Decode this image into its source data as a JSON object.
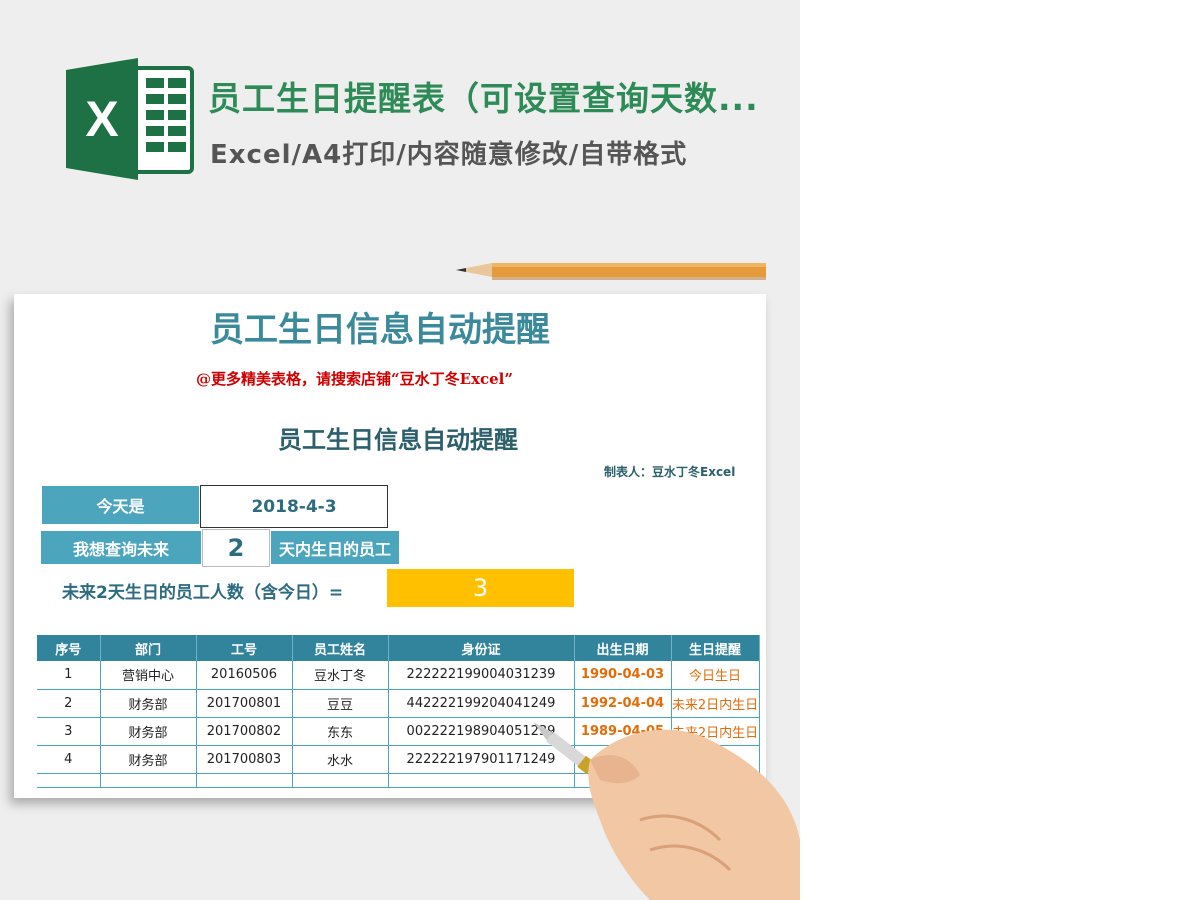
{
  "header": {
    "title": "员工生日提醒表（可设置查询天数...",
    "subtitle": "Excel/A4打印/内容随意修改/自带格式",
    "logo_letter": "X"
  },
  "sheet": {
    "title": "员工生日信息自动提醒",
    "ad": "@更多精美表格，请搜索店铺“豆水丁冬Excel”",
    "subtitle": "员工生日信息自动提醒",
    "maker": "制表人：豆水丁冬Excel",
    "today_label": "今天是",
    "today_value": "2018-4-3",
    "query_label": "我想查询未来",
    "query_days": "2",
    "query_suffix": "天内生日的员工",
    "count_label": "未来2天生日的员工人数（含今日）=",
    "count_value": "3"
  },
  "table": {
    "headers": [
      "序号",
      "部门",
      "工号",
      "员工姓名",
      "身份证",
      "出生日期",
      "生日提醒"
    ],
    "rows": [
      [
        "1",
        "营销中心",
        "20160506",
        "豆水丁冬",
        "222222199004031239",
        "1990-04-03",
        "今日生日"
      ],
      [
        "2",
        "财务部",
        "201700801",
        "豆豆",
        "442222199204041249",
        "1992-04-04",
        "未来2日内生日"
      ],
      [
        "3",
        "财务部",
        "201700802",
        "东东",
        "002222198904051239",
        "1989-04-05",
        "未来2日内生日"
      ],
      [
        "4",
        "财务部",
        "201700803",
        "水水",
        "222222197901171249",
        "",
        ""
      ]
    ]
  },
  "colors": {
    "header_green": "#2e8b57",
    "title_teal": "#3a8a9c",
    "label_blue": "#4aa5bd",
    "table_header": "#31849b",
    "count_yellow": "#ffc000",
    "date_orange": "#e36c09",
    "ad_red": "#d00000"
  }
}
